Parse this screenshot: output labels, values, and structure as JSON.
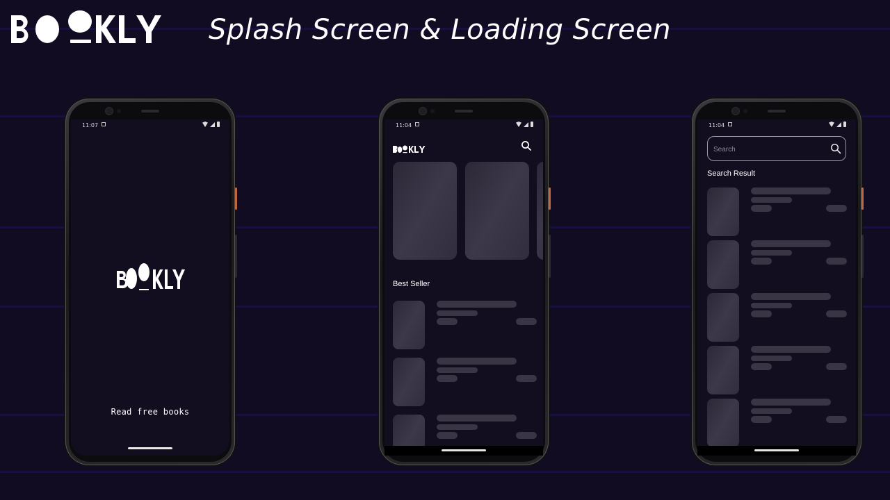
{
  "header": {
    "brand": "BOOKLY",
    "headline": "Splash Screen & Loading Screen"
  },
  "colors": {
    "background": "#120c22",
    "stripe": "#1a1245",
    "screen": "#120d1f",
    "skeleton": "#3a3545",
    "accent_button": "#c2673c"
  },
  "splash": {
    "status_time": "11:07",
    "logo": "BOOKLY",
    "tagline": "Read free books"
  },
  "home": {
    "status_time": "11:04",
    "logo": "BOOKLY",
    "search_icon": "search-icon",
    "best_seller_title": "Best Seller",
    "featured_placeholders": 3,
    "list_placeholders": 3
  },
  "search": {
    "status_time": "11:04",
    "placeholder": "Search",
    "search_icon": "search-icon",
    "results_title": "Search Result",
    "result_placeholders": 5
  }
}
